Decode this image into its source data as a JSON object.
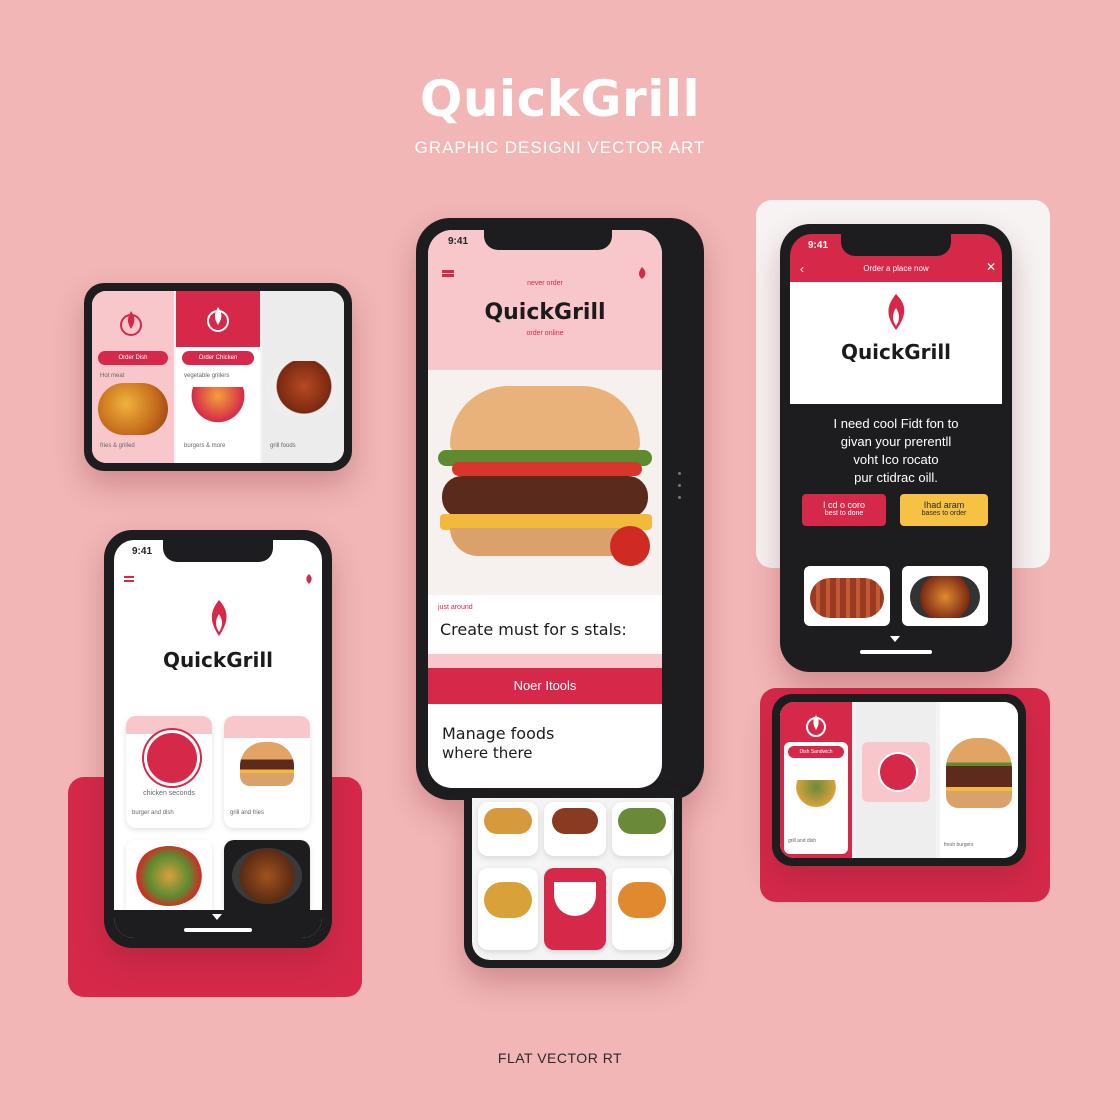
{
  "header": {
    "title": "QuickGrill",
    "subtitle": "GRAPHIC DESIGNI VECTOR ART"
  },
  "footer": {
    "text": "FLAT VECTOR RT"
  },
  "colors": {
    "background": "#f2b6b6",
    "accent_red": "#d6294a",
    "accent_yellow": "#f6c243",
    "phone_frame": "#1d1d1f"
  },
  "main_phone": {
    "time": "9:41",
    "brand_top": "never order",
    "brand": "QuickGrill",
    "brand_sub": "order online",
    "small_label": "just around",
    "headline": "Create must for s stals:",
    "cta": "Noer Itools",
    "bottom_text_line1": "Manage foods",
    "bottom_text_line2": "where there",
    "icons": [
      "menu-icon",
      "flame-icon"
    ]
  },
  "right_phone": {
    "time": "9:41",
    "header_title": "Order a place now",
    "brand": "QuickGrill",
    "body_line1": "I need cool Fidt fon to",
    "body_line2": "givan your prerentll",
    "body_line3": "voht Ico rocato",
    "body_line4": "pur ctidrac oill.",
    "button_red": "I cd o coro",
    "button_red_sub": "best to done",
    "button_yellow": "Ihad aram",
    "button_yellow_sub": "bases to order",
    "icons": [
      "back-icon",
      "close-icon",
      "flame-icon",
      "chevron-down-icon"
    ]
  },
  "left_bottom_phone": {
    "time": "9:41",
    "brand": "QuickGrill",
    "card_label": "chicken seconds",
    "card_caption": "burger and dish",
    "card_caption2": "grill and fries",
    "icons": [
      "menu-icon",
      "flame-icon",
      "chevron-down-icon"
    ]
  },
  "small_left_phone": {
    "button1": "Order Dish",
    "button2": "Order Chicken",
    "label1": "Hot meat",
    "label2": "vegetable grillers",
    "caption1": "fries & grilled",
    "caption2": "burgers & more",
    "caption3": "grill foods"
  },
  "small_right_phone": {
    "button1": "Dish Sandwich",
    "caption1": "grill and dish",
    "caption2": "fresh burgers"
  }
}
